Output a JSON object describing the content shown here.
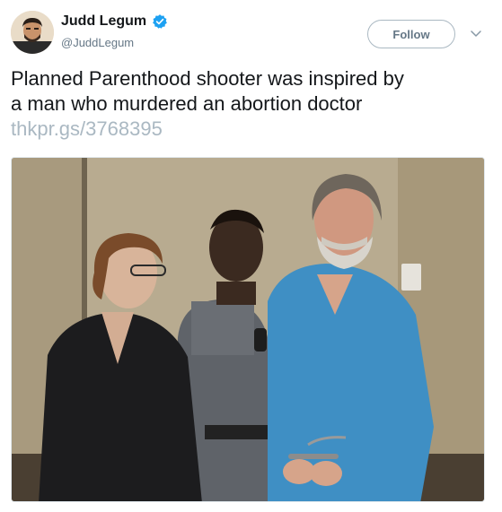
{
  "author": {
    "display_name": "Judd Legum",
    "handle": "@JuddLegum",
    "verified": true,
    "avatar_icon": "person-portrait-icon"
  },
  "actions": {
    "follow_label": "Follow",
    "menu_icon": "chevron-down-icon"
  },
  "tweet": {
    "text_line1": "Planned Parenthood shooter was inspired by",
    "text_line2": "a man who murdered an abortion doctor",
    "link": "thkpr.gs/3768395"
  },
  "media": {
    "type": "photo",
    "icon": "courtroom-photo"
  },
  "colors": {
    "text": "#14171a",
    "secondary": "#657786",
    "link": "#aab8c2",
    "verified": "#1da1f2",
    "border": "#aab8c2"
  }
}
